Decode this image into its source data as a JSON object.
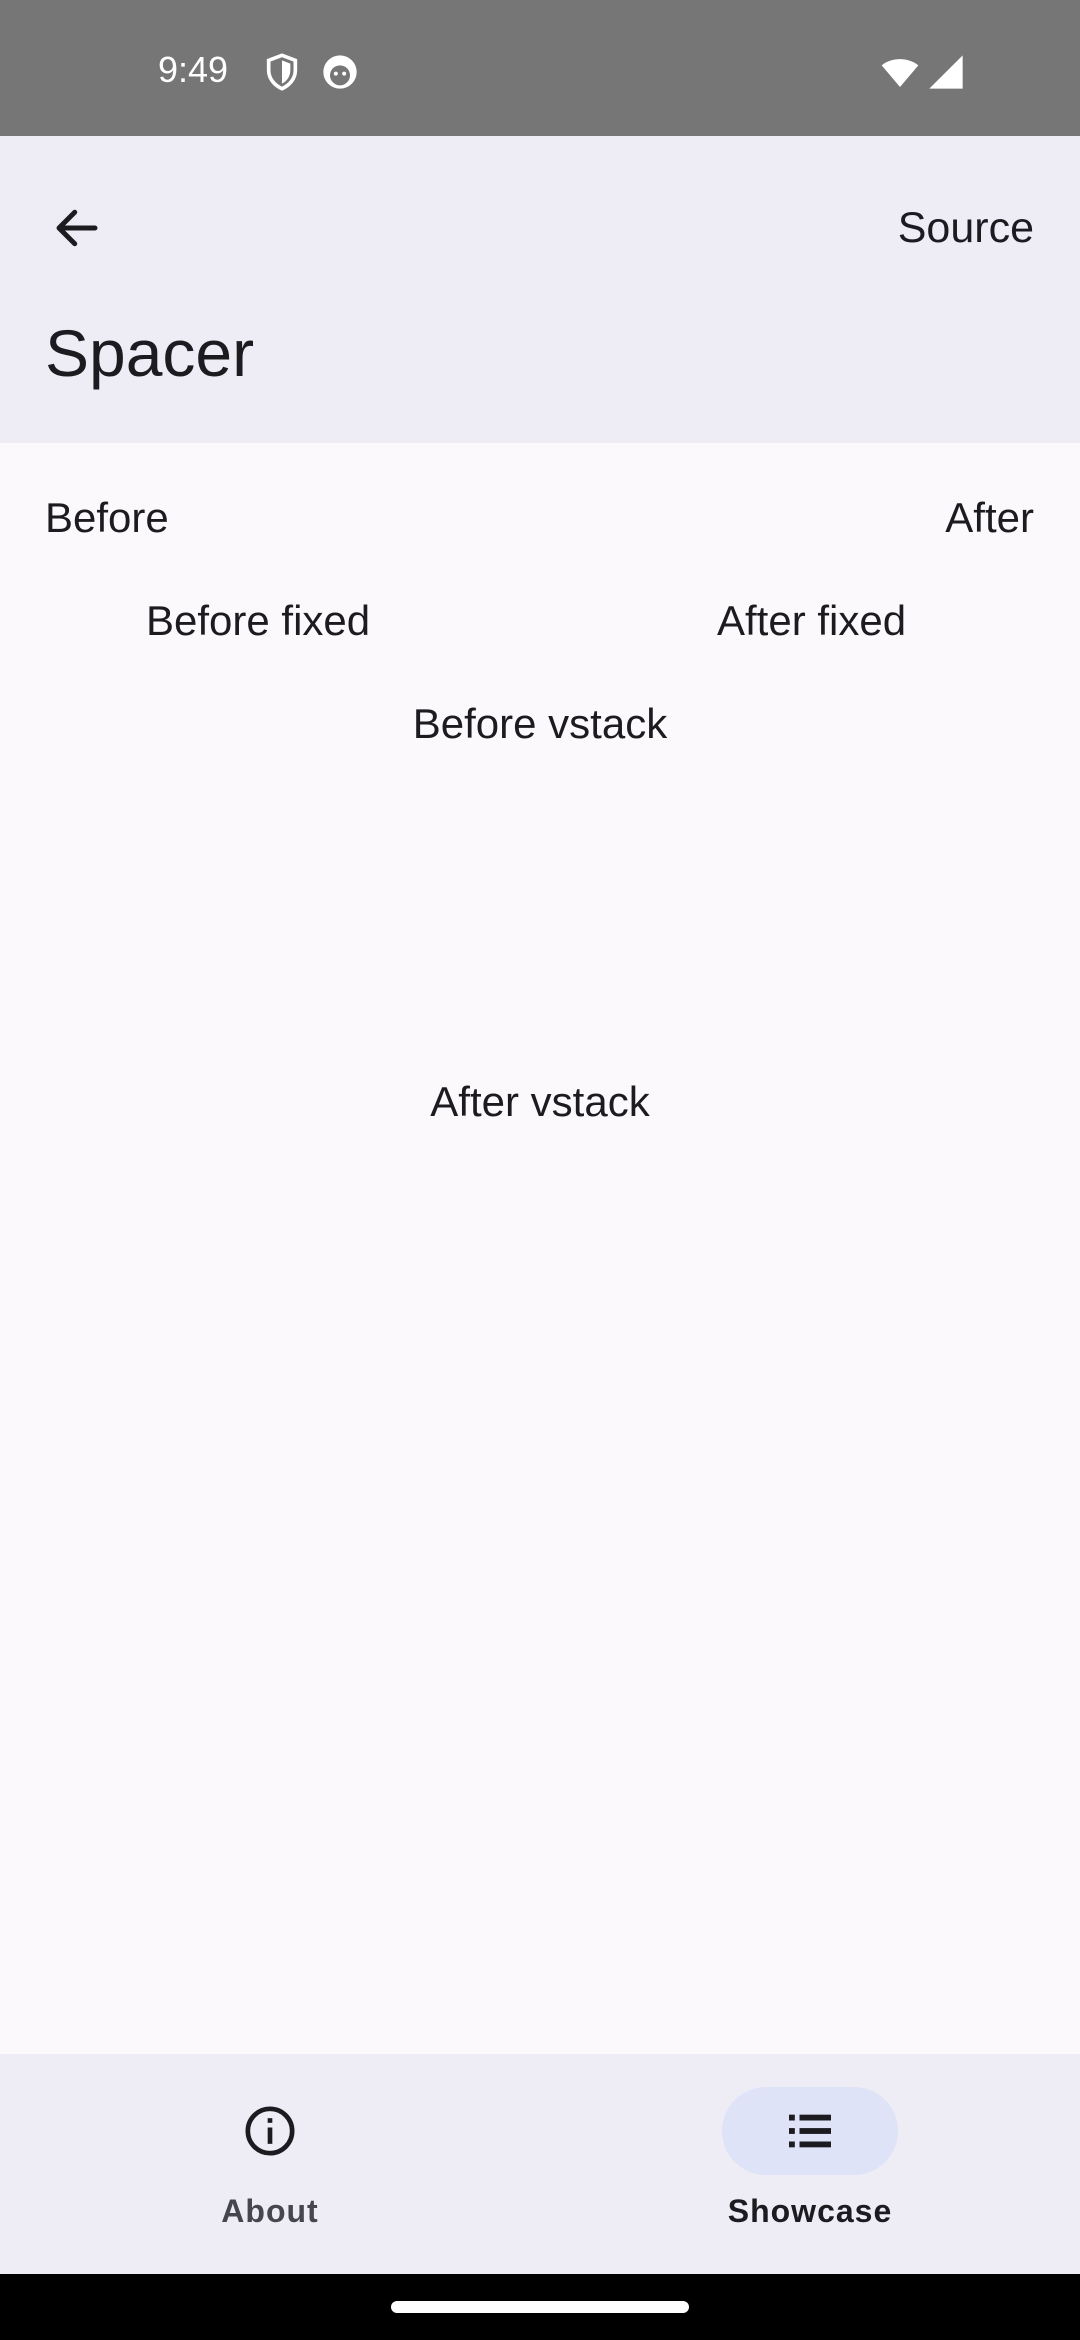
{
  "status_bar": {
    "time": "9:49",
    "icons": [
      "shield-icon",
      "face-icon",
      "wifi-icon",
      "signal-icon"
    ],
    "background": "#767676"
  },
  "app_bar": {
    "back_icon": "arrow-back-icon",
    "action_label": "Source",
    "title": "Spacer",
    "background": "#eeedf6"
  },
  "content": {
    "row1": {
      "before": "Before",
      "after": "After"
    },
    "row2": {
      "before": "Before fixed",
      "after": "After fixed"
    },
    "vstack": {
      "before": "Before vstack",
      "after": "After vstack"
    }
  },
  "bottom_nav": {
    "items": [
      {
        "label": "About",
        "icon": "info-icon",
        "selected": false
      },
      {
        "label": "Showcase",
        "icon": "list-icon",
        "selected": true
      }
    ],
    "indicator_color": "#dfe3f7"
  }
}
